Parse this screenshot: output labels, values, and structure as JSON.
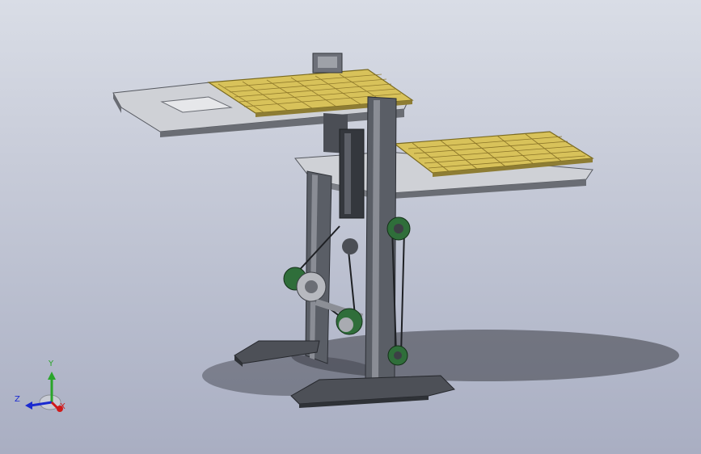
{
  "viewport": {
    "background_top": "#d9dde6",
    "background_bottom": "#a9aec2"
  },
  "model": {
    "pcb_color": "#d8c25a",
    "frame_color": "#5a5e66",
    "plate_color": "#c9cbd0",
    "bearing_color": "#2f6e3a"
  },
  "triad": {
    "x_label": "X",
    "y_label": "Y",
    "z_label": "Z",
    "x_color": "#d01a1a",
    "y_color": "#2aa52a",
    "z_color": "#1a2ad0"
  }
}
